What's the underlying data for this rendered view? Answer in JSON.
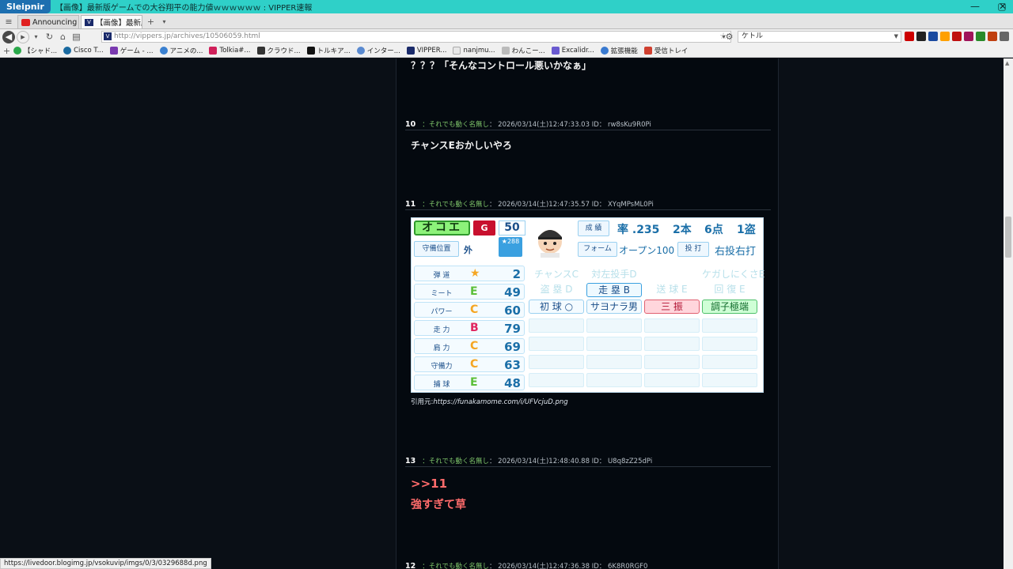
{
  "window": {
    "brand": "Sleipnir",
    "title": "【画像】最新版ゲームでの大谷翔平の能力値ｗｗｗｗｗｗ : VIPPER速報"
  },
  "tabs": [
    {
      "label": "Announcing N..."
    },
    {
      "label": "【画像】最新版ゲ..."
    }
  ],
  "address": {
    "url": "http://vippers.jp/archives/10506059.html",
    "search_value": "ケトル"
  },
  "bookmarks": [
    {
      "label": "【シャド..."
    },
    {
      "label": "Cisco T..."
    },
    {
      "label": "ゲーム - ..."
    },
    {
      "label": "アニメの..."
    },
    {
      "label": "Tolkia#..."
    },
    {
      "label": "クラウド..."
    },
    {
      "label": "トルキア..."
    },
    {
      "label": "インター..."
    },
    {
      "label": "VIPPER..."
    },
    {
      "label": "nanjmu..."
    },
    {
      "label": "わんこー..."
    },
    {
      "label": "Excalidr..."
    },
    {
      "label": "拡張機能"
    },
    {
      "label": "受信トレイ"
    }
  ],
  "posts": {
    "prev_text": "？？？「そんなコントロール悪いかなぁ」",
    "p10": {
      "num": "10",
      "name": "：それでも動く名無し",
      "meta": "： 2026/03/14(土)12:47:33.03 ID： rw8sKu9R0Pi",
      "text": "チャンスEおかしいやろ"
    },
    "p11": {
      "num": "11",
      "name": "：それでも動く名無し",
      "meta": "： 2026/03/14(土)12:47:35.57 ID： XYqMPsML0Pi",
      "cite_prefix": "引用元:",
      "cite_url": "https://funakamome.com/i/UFVcjuD.png"
    },
    "p13": {
      "num": "13",
      "name": "：それでも動く名無し",
      "meta": "： 2026/03/14(土)12:48:40.88 ID： U8q8zZ25dPi",
      "anchor": ">>11",
      "text": "強すぎて草"
    },
    "p12": {
      "num": "12",
      "name": "：それでも動く名無し",
      "meta": "： 2026/03/14(土)12:47:36.38 ID： 6K8R0RGF0"
    }
  },
  "card": {
    "name": "オコエ",
    "team": "G",
    "number": "50",
    "rating": "288",
    "position_label": "守備位置",
    "position": "外",
    "avg_label": "成 績",
    "avg": "率 .235",
    "hr": "2本",
    "rbi": "6点",
    "sb": "1盗",
    "form_label": "フォーム",
    "form": "オープン100",
    "throwbat_label": "投 打",
    "throwbat": "右投右打",
    "stats": [
      {
        "label": "弾 道",
        "grade": "★",
        "value": "2",
        "color": "#f5a623"
      },
      {
        "label": "ミート",
        "grade": "E",
        "value": "49",
        "color": "#5cbf3a"
      },
      {
        "label": "パワー",
        "grade": "C",
        "value": "60",
        "color": "#f5a623"
      },
      {
        "label": "走 力",
        "grade": "B",
        "value": "79",
        "color": "#e0245e"
      },
      {
        "label": "肩 力",
        "grade": "C",
        "value": "69",
        "color": "#f5a623"
      },
      {
        "label": "守備力",
        "grade": "C",
        "value": "63",
        "color": "#f5a623"
      },
      {
        "label": "捕 球",
        "grade": "E",
        "value": "48",
        "color": "#5cbf3a"
      }
    ],
    "abilities_row1": [
      "チャンスC",
      "対左投手D",
      "",
      "ケガしにくさE"
    ],
    "abilities_row2": [
      "盗 塁 D",
      "走 塁 B",
      "送 球 E",
      "回 復 E"
    ],
    "abilities_row3": [
      "初 球 ○",
      "サヨナラ男",
      "三 振",
      "調子極端"
    ]
  },
  "status_url": "https://livedoor.blogimg.jp/vsokuvip/imgs/0/3/0329688d.png"
}
